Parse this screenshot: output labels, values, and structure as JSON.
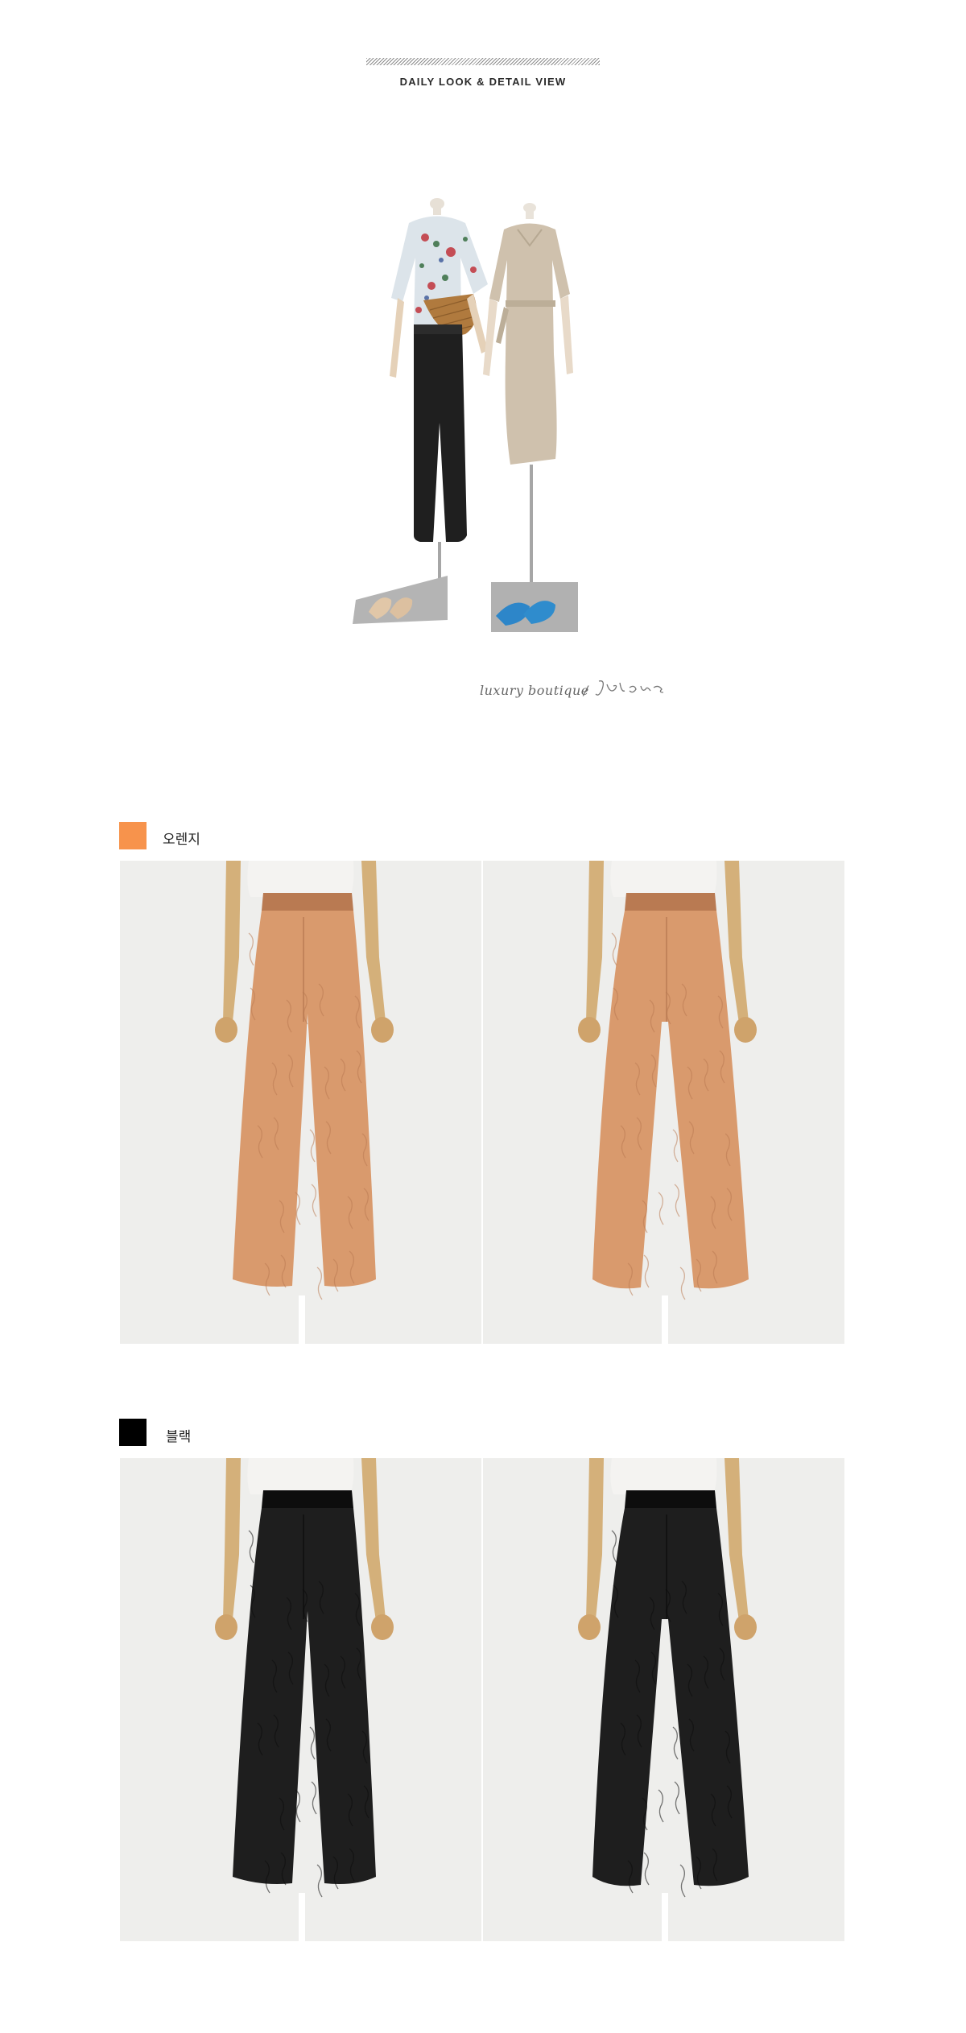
{
  "header": {
    "title": "DAILY LOOK & DETAIL VIEW"
  },
  "brand": {
    "tagline": "luxury boutique",
    "slash": "/",
    "signature": "Jblanc"
  },
  "colors": [
    {
      "label": "오렌지",
      "swatch_color": "#f7934c",
      "pants_color": "#d99a6d",
      "pants_shadow": "#b97a52"
    },
    {
      "label": "블랙",
      "swatch_color": "#000000",
      "pants_color": "#1e1e1e",
      "pants_shadow": "#0d0d0d"
    }
  ],
  "photos": {
    "background": "#eeeeec",
    "views": [
      "front",
      "back"
    ]
  }
}
